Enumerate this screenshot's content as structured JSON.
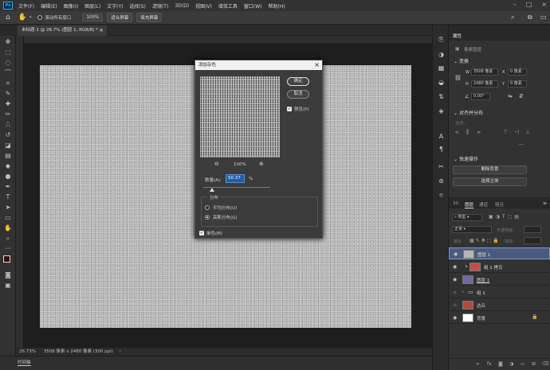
{
  "app": {
    "logo": "Ps"
  },
  "menu": [
    "文件(F)",
    "编辑(E)",
    "图像(I)",
    "图层(L)",
    "文字(Y)",
    "选择(S)",
    "滤镜(T)",
    "3D(D)",
    "视图(V)",
    "增效工具",
    "窗口(W)",
    "帮助(H)"
  ],
  "window_controls": [
    "minimize-icon",
    "maximize-icon",
    "close-icon"
  ],
  "options": {
    "scroll_all": "滚动所有窗口",
    "zoom": "100%",
    "fit_screen": "适合屏幕",
    "fill_screen": "填充屏幕"
  },
  "document": {
    "tab_title": "未标题-1 @ 26.7% (图层 1, RGB/8) *",
    "tab_close": "×"
  },
  "status": {
    "zoom": "26.73%",
    "info": "3508 像素 x 2480 像素 (300 ppi)"
  },
  "timeline": {
    "label": "时间轴"
  },
  "dialog": {
    "title": "添加杂色",
    "close": "×",
    "ok": "确定",
    "cancel": "取消",
    "preview_label": "预览(P)",
    "zoom_out": "⊖",
    "zoom_level": "100%",
    "zoom_in": "⊕",
    "amount_label": "数量(A):",
    "amount_value": "50.37",
    "amount_unit": "%",
    "amount_fraction": 0.1259,
    "distribution_label": "分布",
    "uniform": "平均分布(U)",
    "gaussian": "高斯分布(G)",
    "mono": "单色(M)"
  },
  "properties": {
    "tab": "属性",
    "pixel_layer": "像素图层",
    "transform": "变换",
    "w_label": "W",
    "w_value": "3508 像素",
    "h_label": "H",
    "h_value": "2480 像素",
    "x_label": "X",
    "x_value": "0 像素",
    "y_label": "Y",
    "y_value": "0 像素",
    "angle": "0.00°",
    "align": "对齐并分布",
    "align_sub": "对齐:",
    "more": "···",
    "quick_actions": "快速操作",
    "remove_bg": "删除背景",
    "select_subject": "选择主体"
  },
  "layers_panel": {
    "tabs": [
      "3D",
      "图层",
      "通道",
      "路径"
    ],
    "kind": "类型",
    "blend_mode": "正常",
    "opacity_label": "不透明度:",
    "lock_label": "锁定:",
    "fill_label": "填充:",
    "layers": [
      {
        "name": "图层 1",
        "selected": true
      },
      {
        "name": "组 1 拷贝",
        "selected": false
      },
      {
        "name": "图层 1",
        "selected": false
      },
      {
        "name": "组 1",
        "selected": false
      },
      {
        "name": "达丘",
        "selected": false
      },
      {
        "name": "背景",
        "selected": false
      }
    ]
  }
}
